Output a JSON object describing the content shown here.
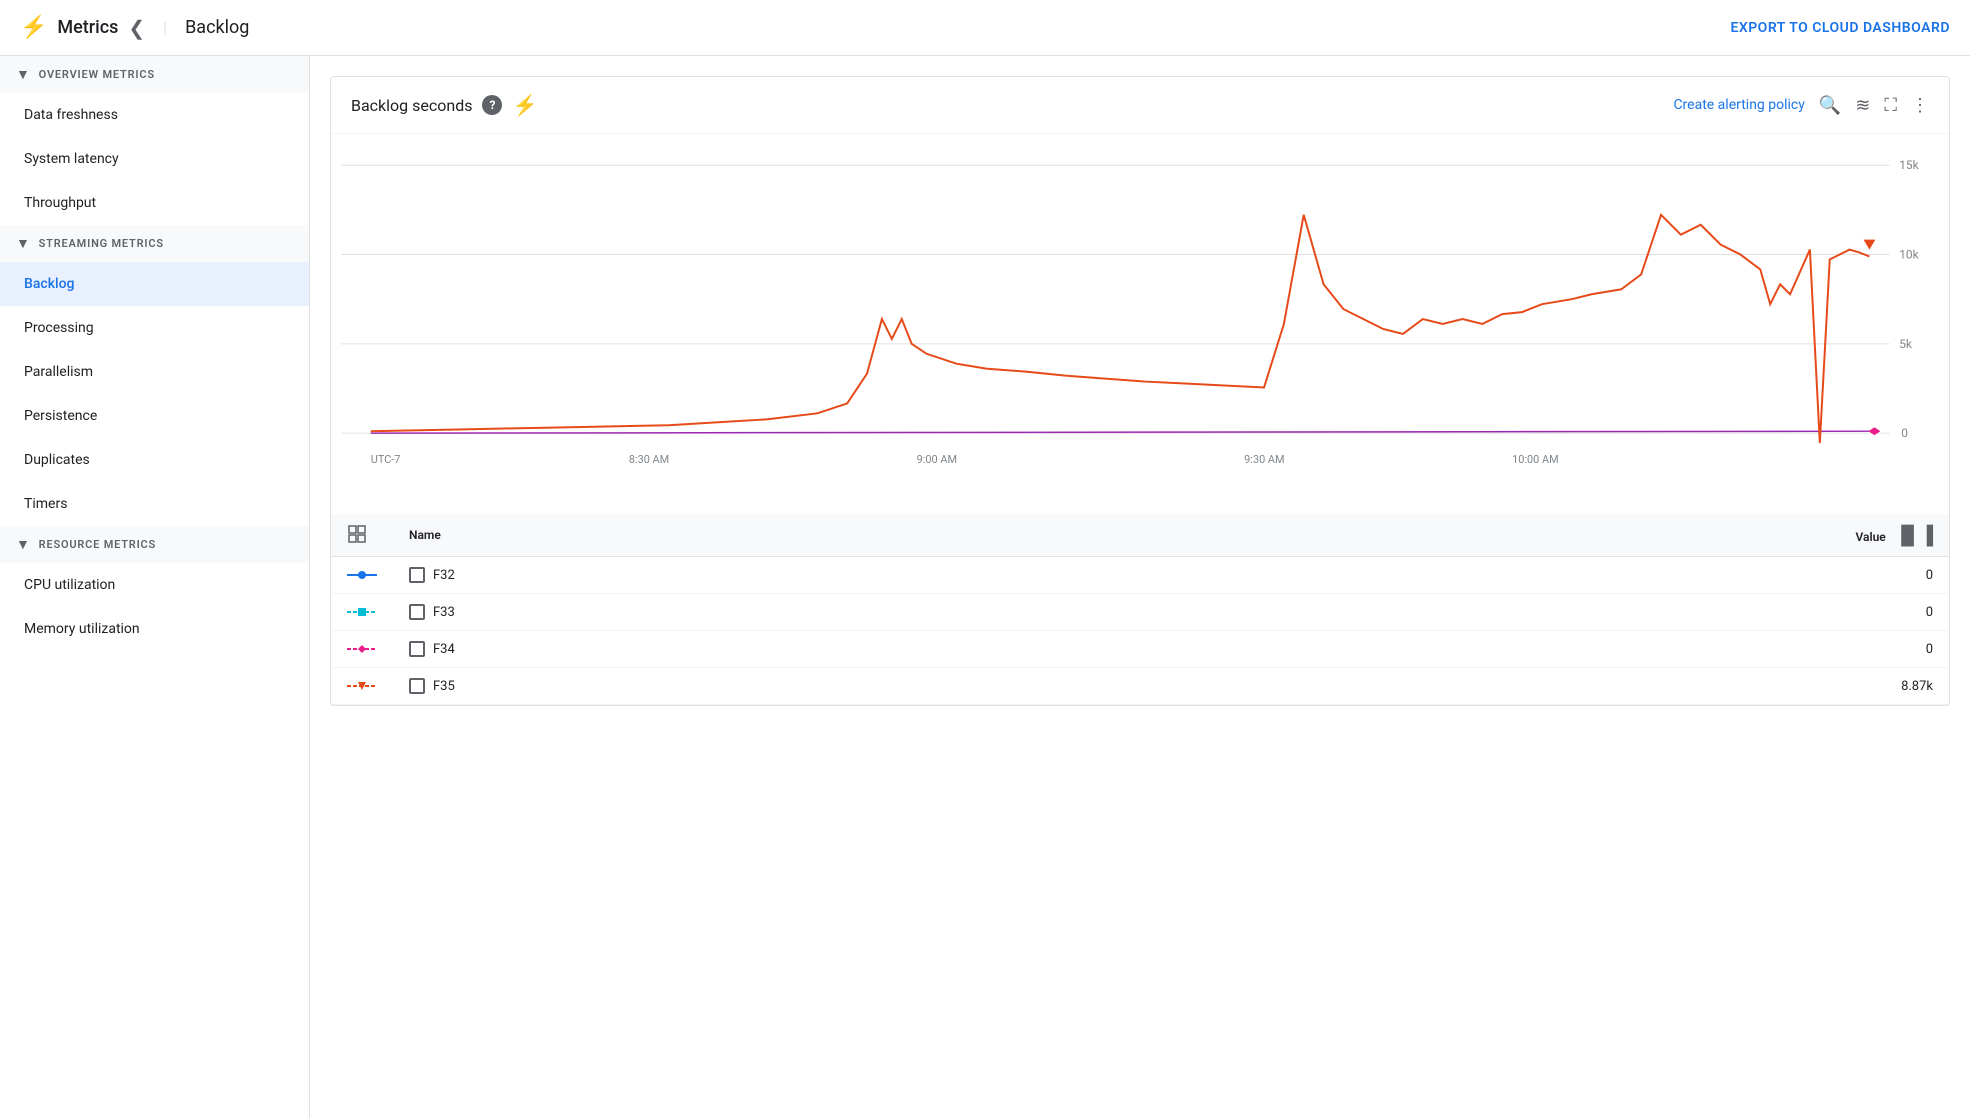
{
  "header": {
    "app_title": "Metrics",
    "page_title": "Backlog",
    "export_label": "EXPORT TO CLOUD DASHBOARD",
    "collapse_icon": "❮"
  },
  "sidebar": {
    "overview_section": {
      "label": "OVERVIEW METRICS",
      "items": [
        {
          "id": "data-freshness",
          "label": "Data freshness"
        },
        {
          "id": "system-latency",
          "label": "System latency"
        },
        {
          "id": "throughput",
          "label": "Throughput"
        }
      ]
    },
    "streaming_section": {
      "label": "STREAMING METRICS",
      "items": [
        {
          "id": "backlog",
          "label": "Backlog",
          "active": true
        },
        {
          "id": "processing",
          "label": "Processing"
        },
        {
          "id": "parallelism",
          "label": "Parallelism"
        },
        {
          "id": "persistence",
          "label": "Persistence"
        },
        {
          "id": "duplicates",
          "label": "Duplicates"
        },
        {
          "id": "timers",
          "label": "Timers"
        }
      ]
    },
    "resource_section": {
      "label": "RESOURCE METRICS",
      "items": [
        {
          "id": "cpu-utilization",
          "label": "CPU utilization"
        },
        {
          "id": "memory-utilization",
          "label": "Memory utilization"
        }
      ]
    }
  },
  "chart": {
    "title": "Backlog seconds",
    "create_alerting_label": "Create alerting policy",
    "y_labels": [
      "15k",
      "10k",
      "5k",
      "0"
    ],
    "x_labels": [
      "UTC-7",
      "8:30 AM",
      "9:00 AM",
      "9:30 AM",
      "10:00 AM"
    ],
    "legend": {
      "name_col": "Name",
      "value_col": "Value",
      "rows": [
        {
          "id": "F32",
          "label": "F32",
          "color_line": "#1a73e8",
          "marker": "dot",
          "marker_color": "#1a73e8",
          "value": "0"
        },
        {
          "id": "F33",
          "label": "F33",
          "color_line": "#00bcd4",
          "marker": "square",
          "marker_color": "#00bcd4",
          "value": "0"
        },
        {
          "id": "F34",
          "label": "F34",
          "color_line": "#e91e8c",
          "marker": "diamond",
          "marker_color": "#e91e8c",
          "value": "0"
        },
        {
          "id": "F35",
          "label": "F35",
          "color_line": "#e64a19",
          "marker": "triangle",
          "marker_color": "#e64a19",
          "value": "8.87k"
        }
      ]
    }
  }
}
